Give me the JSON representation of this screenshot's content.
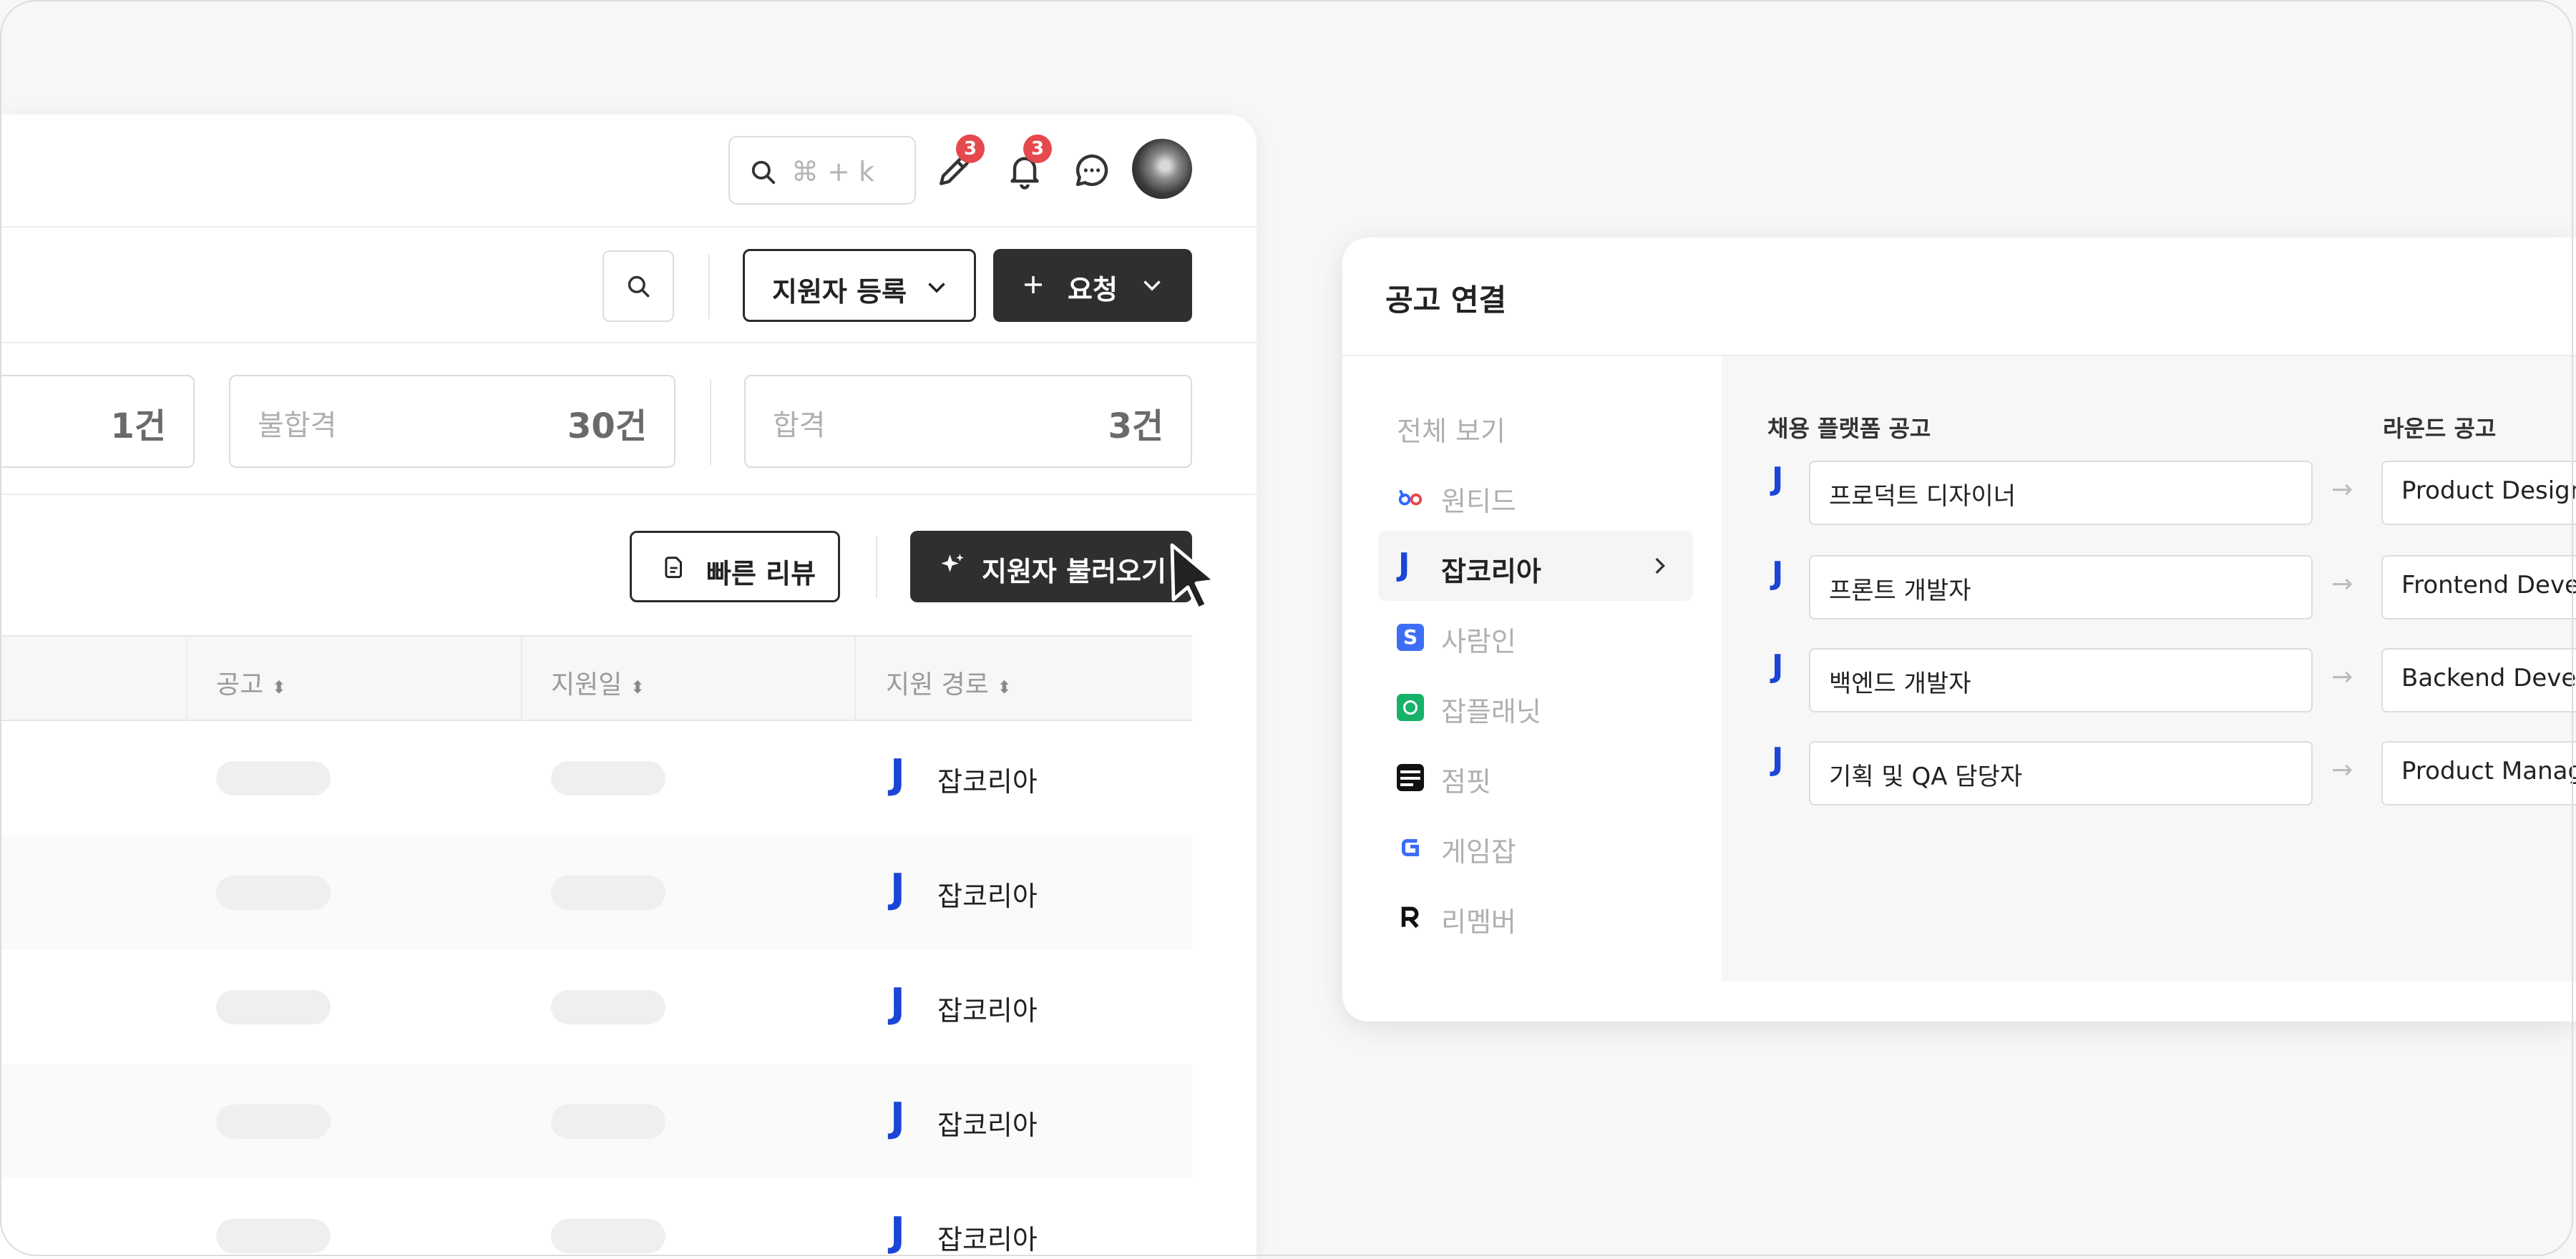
{
  "header": {
    "search_shortcut": "⌘ + k",
    "edit_badge": "3",
    "bell_badge": "3"
  },
  "toolbar": {
    "register_label": "지원자 등록",
    "request_label": "요청"
  },
  "stats": [
    {
      "label": "",
      "value": "1건"
    },
    {
      "label": "불합격",
      "value": "30건"
    },
    {
      "label": "합격",
      "value": "3건"
    }
  ],
  "actions": {
    "quick_review_label": "빠른 리뷰",
    "import_label": "지원자 불러오기"
  },
  "table": {
    "columns": [
      "공고",
      "지원일",
      "지원 경로"
    ],
    "rows": [
      {
        "source": "잡코리아"
      },
      {
        "source": "잡코리아"
      },
      {
        "source": "잡코리아"
      },
      {
        "source": "잡코리아"
      },
      {
        "source": "잡코리아"
      }
    ]
  },
  "panel": {
    "title": "공고 연결",
    "sidebar": [
      {
        "label": "전체 보기",
        "icon": ""
      },
      {
        "label": "원티드",
        "icon": "wanted-icon"
      },
      {
        "label": "잡코리아",
        "icon": "jobkorea-icon",
        "active": true
      },
      {
        "label": "사람인",
        "icon": "saramin-icon"
      },
      {
        "label": "잡플래닛",
        "icon": "jobplanet-icon"
      },
      {
        "label": "점핏",
        "icon": "jumpit-icon"
      },
      {
        "label": "게임잡",
        "icon": "gamejob-icon"
      },
      {
        "label": "리멤버",
        "icon": "remember-icon"
      }
    ],
    "col_platform": "채용 플랫폼 공고",
    "col_round": "라운드 공고",
    "mappings": [
      {
        "platform": "프로덕트 디자이너",
        "round": "Product Designer"
      },
      {
        "platform": "프론트 개발자",
        "round": "Frontend Developer"
      },
      {
        "platform": "백엔드 개발자",
        "round": "Backend Developer"
      },
      {
        "platform": "기획 및 QA 담당자",
        "round": "Product Manager"
      }
    ]
  },
  "colors": {
    "dark_button": "#2f2f2f",
    "badge": "#e5484d",
    "jobkorea_blue": "#1a45d6"
  }
}
